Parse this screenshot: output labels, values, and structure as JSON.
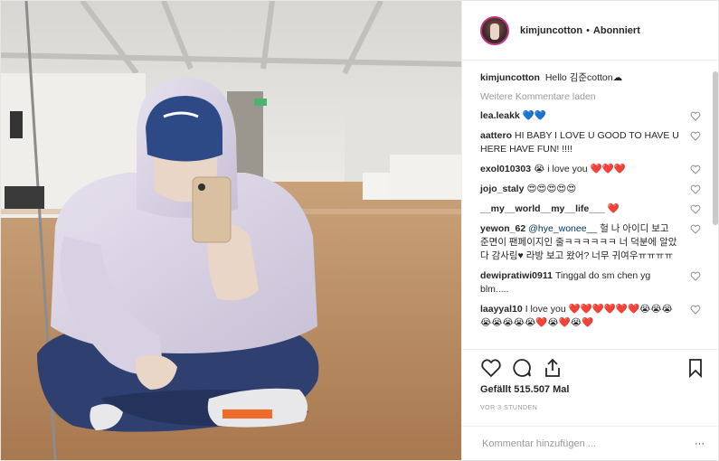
{
  "post": {
    "author": "kimjuncotton",
    "separator": "•",
    "follow_status": "Abonniert",
    "caption_user": "kimjuncotton",
    "caption_text": "Hello 김준cotton☁",
    "load_more": "Weitere Kommentare laden",
    "likes": "Gefällt 515.507 Mal",
    "time": "VOR 3 STUNDEN",
    "comment_placeholder": "Kommentar hinzufügen ...",
    "more_icon": "···"
  },
  "comments": [
    {
      "user": "lea.leakk",
      "text": "💙💙"
    },
    {
      "user": "aattero",
      "text": "HI BABY I LOVE U GOOD TO HAVE U HERE HAVE FUN! !!!!"
    },
    {
      "user": "exol010303",
      "text": "😭 i love you ❤️❤️❤️"
    },
    {
      "user": "jojo_staly",
      "text": "😍😍😍😍😍"
    },
    {
      "user": "__my__world__my__life___",
      "text": "❤️"
    },
    {
      "user": "yewon_62",
      "mention": "@hye_wonee__",
      "text": "헐 나 아이디 보고 준면이 팬페이지인 줄ㅋㅋㅋㅋㅋㅋ 너 덕분에 알았다 감사링♥ 라방 보고 왔어? 너무 귀여우ㅠㅠㅠㅠ"
    },
    {
      "user": "dewipratiwi0911",
      "text": "Tinggal do sm chen yg blm....."
    },
    {
      "user": "laayyal10",
      "text": "I love you ❤️❤️❤️❤️❤️❤️😭😭😭😭😭😭😭😭❤️😭❤️😭❤️"
    }
  ],
  "colors": {
    "accent_link": "#003569",
    "muted": "#999999",
    "text": "#262626"
  }
}
